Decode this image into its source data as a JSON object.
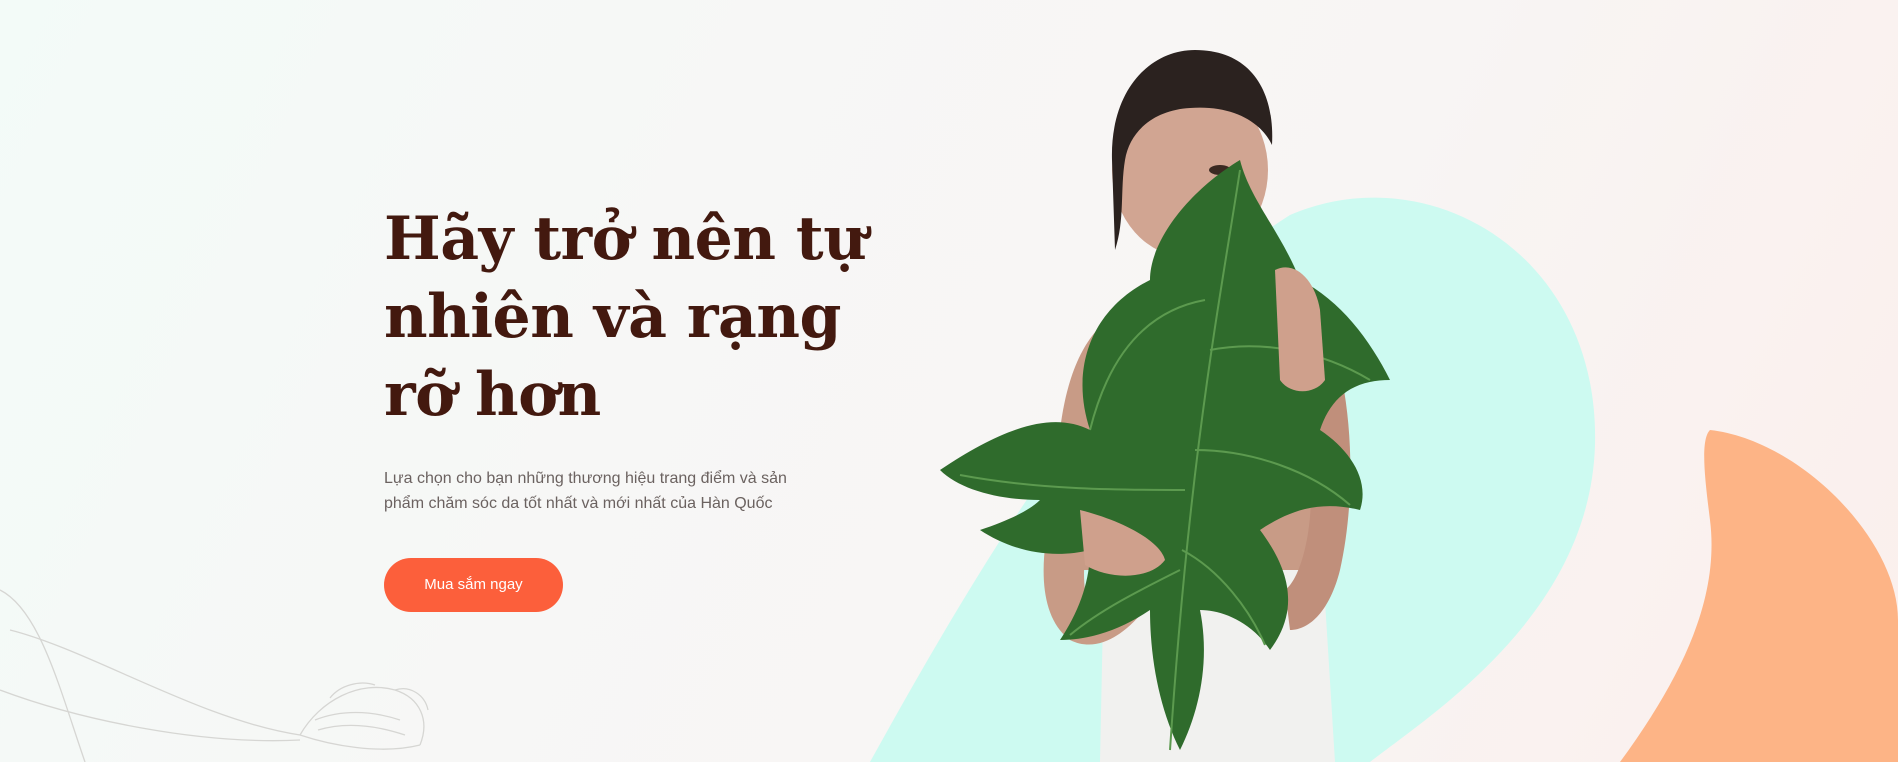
{
  "hero": {
    "title": "Hãy trở nên tự nhiên và rạng rỡ hơn",
    "description": "Lựa chọn cho bạn những thương hiệu trang điểm và sản phẩm chăm sóc da tốt nhất và mới nhất của Hàn Quốc",
    "cta_label": "Mua sắm ngay",
    "image_icon": "woman-holding-leaf-photo"
  },
  "colors": {
    "title": "#43190f",
    "body_text": "#6b6260",
    "button": "#fc5f3b",
    "mint": "#cdfaf1",
    "peach": "#fdb486",
    "leaf": "#2f6b2c"
  }
}
